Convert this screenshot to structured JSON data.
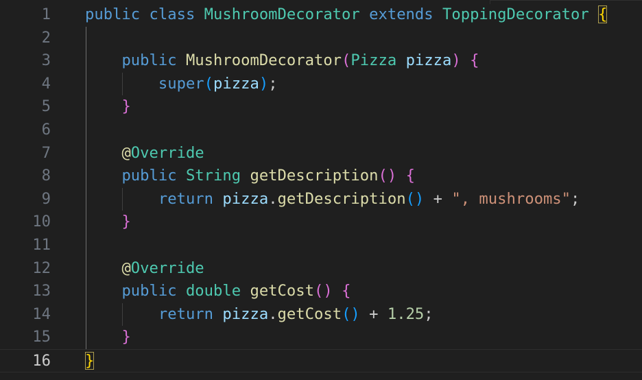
{
  "editor": {
    "language": "java",
    "active_line": "16",
    "colors": {
      "background": "#1f1f1f",
      "line_number": "#6e7681",
      "line_number_active": "#cccccc",
      "keyword": "#569cd6",
      "type": "#4ec9b0",
      "function": "#dcdcaa",
      "variable": "#9cdcfe",
      "string": "#ce9178",
      "number": "#b5cea8",
      "bracket_level_1": "#ffd700",
      "bracket_level_2": "#da70d6",
      "bracket_level_3": "#179fff"
    },
    "lines": [
      {
        "number": "1",
        "tokens": [
          {
            "t": "public",
            "k": "kw"
          },
          {
            "t": " ",
            "k": "pl"
          },
          {
            "t": "class",
            "k": "kw"
          },
          {
            "t": " ",
            "k": "pl"
          },
          {
            "t": "MushroomDecorator",
            "k": "type"
          },
          {
            "t": " ",
            "k": "pl"
          },
          {
            "t": "extends",
            "k": "kw"
          },
          {
            "t": " ",
            "k": "pl"
          },
          {
            "t": "ToppingDecorator",
            "k": "type"
          },
          {
            "t": " ",
            "k": "pl"
          },
          {
            "t": "{",
            "k": "br1",
            "match": true
          }
        ]
      },
      {
        "number": "2",
        "tokens": []
      },
      {
        "number": "3",
        "tokens": [
          {
            "t": "    ",
            "k": "pl"
          },
          {
            "t": "public",
            "k": "kw"
          },
          {
            "t": " ",
            "k": "pl"
          },
          {
            "t": "MushroomDecorator",
            "k": "fn"
          },
          {
            "t": "(",
            "k": "br2"
          },
          {
            "t": "Pizza",
            "k": "type"
          },
          {
            "t": " ",
            "k": "pl"
          },
          {
            "t": "pizza",
            "k": "var"
          },
          {
            "t": ")",
            "k": "br2"
          },
          {
            "t": " ",
            "k": "pl"
          },
          {
            "t": "{",
            "k": "br2"
          }
        ]
      },
      {
        "number": "4",
        "tokens": [
          {
            "t": "        ",
            "k": "pl"
          },
          {
            "t": "super",
            "k": "kw"
          },
          {
            "t": "(",
            "k": "br3"
          },
          {
            "t": "pizza",
            "k": "var"
          },
          {
            "t": ")",
            "k": "br3"
          },
          {
            "t": ";",
            "k": "pl"
          }
        ]
      },
      {
        "number": "5",
        "tokens": [
          {
            "t": "    ",
            "k": "pl"
          },
          {
            "t": "}",
            "k": "br2"
          }
        ]
      },
      {
        "number": "6",
        "tokens": []
      },
      {
        "number": "7",
        "tokens": [
          {
            "t": "    ",
            "k": "pl"
          },
          {
            "t": "@",
            "k": "ann"
          },
          {
            "t": "Override",
            "k": "type"
          }
        ]
      },
      {
        "number": "8",
        "tokens": [
          {
            "t": "    ",
            "k": "pl"
          },
          {
            "t": "public",
            "k": "kw"
          },
          {
            "t": " ",
            "k": "pl"
          },
          {
            "t": "String",
            "k": "type"
          },
          {
            "t": " ",
            "k": "pl"
          },
          {
            "t": "getDescription",
            "k": "fn"
          },
          {
            "t": "()",
            "k": "br2"
          },
          {
            "t": " ",
            "k": "pl"
          },
          {
            "t": "{",
            "k": "br2"
          }
        ]
      },
      {
        "number": "9",
        "tokens": [
          {
            "t": "        ",
            "k": "pl"
          },
          {
            "t": "return",
            "k": "kw"
          },
          {
            "t": " ",
            "k": "pl"
          },
          {
            "t": "pizza",
            "k": "var"
          },
          {
            "t": ".",
            "k": "pl"
          },
          {
            "t": "getDescription",
            "k": "fn"
          },
          {
            "t": "()",
            "k": "br3"
          },
          {
            "t": " + ",
            "k": "pl"
          },
          {
            "t": "\", mushrooms\"",
            "k": "str"
          },
          {
            "t": ";",
            "k": "pl"
          }
        ]
      },
      {
        "number": "10",
        "tokens": [
          {
            "t": "    ",
            "k": "pl"
          },
          {
            "t": "}",
            "k": "br2"
          }
        ]
      },
      {
        "number": "11",
        "tokens": []
      },
      {
        "number": "12",
        "tokens": [
          {
            "t": "    ",
            "k": "pl"
          },
          {
            "t": "@",
            "k": "ann"
          },
          {
            "t": "Override",
            "k": "type"
          }
        ]
      },
      {
        "number": "13",
        "tokens": [
          {
            "t": "    ",
            "k": "pl"
          },
          {
            "t": "public",
            "k": "kw"
          },
          {
            "t": " ",
            "k": "pl"
          },
          {
            "t": "double",
            "k": "type"
          },
          {
            "t": " ",
            "k": "pl"
          },
          {
            "t": "getCost",
            "k": "fn"
          },
          {
            "t": "()",
            "k": "br2"
          },
          {
            "t": " ",
            "k": "pl"
          },
          {
            "t": "{",
            "k": "br2"
          }
        ]
      },
      {
        "number": "14",
        "tokens": [
          {
            "t": "        ",
            "k": "pl"
          },
          {
            "t": "return",
            "k": "kw"
          },
          {
            "t": " ",
            "k": "pl"
          },
          {
            "t": "pizza",
            "k": "var"
          },
          {
            "t": ".",
            "k": "pl"
          },
          {
            "t": "getCost",
            "k": "fn"
          },
          {
            "t": "()",
            "k": "br3"
          },
          {
            "t": " + ",
            "k": "pl"
          },
          {
            "t": "1.25",
            "k": "num"
          },
          {
            "t": ";",
            "k": "pl"
          }
        ]
      },
      {
        "number": "15",
        "tokens": [
          {
            "t": "    ",
            "k": "pl"
          },
          {
            "t": "}",
            "k": "br2"
          }
        ]
      },
      {
        "number": "16",
        "tokens": [
          {
            "t": "}",
            "k": "br1",
            "match": true
          }
        ]
      }
    ]
  }
}
